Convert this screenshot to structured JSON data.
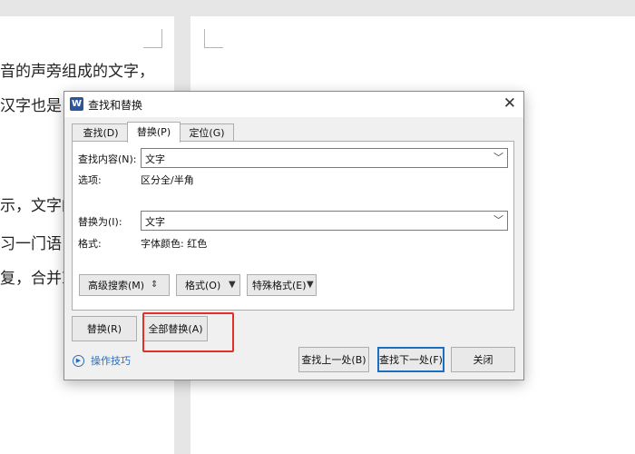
{
  "document": {
    "left_lines": [
      "音的声旁组成的文字，",
      "汉字也是",
      "",
      "示，文字的",
      "习一门语",
      "复，合并I"
    ]
  },
  "dialog": {
    "title": "查找和替换",
    "app_icon_letter": "W",
    "close_glyph": "✕",
    "tabs": [
      {
        "label": "查找(D)",
        "active": false
      },
      {
        "label": "替换(P)",
        "active": true
      },
      {
        "label": "定位(G)",
        "active": false
      }
    ],
    "find": {
      "label": "查找内容(N):",
      "value": "文字"
    },
    "options": {
      "label": "选项:",
      "value": "区分全/半角"
    },
    "replace": {
      "label": "替换为(I):",
      "value": "文字"
    },
    "format": {
      "label": "格式:",
      "value": "字体颜色: 红色"
    },
    "buttons": {
      "advanced_search": "高级搜索(M)",
      "format": "格式(O)",
      "special_format": "特殊格式(E)",
      "replace": "替换(R)",
      "replace_all": "全部替换(A)",
      "find_previous": "查找上一处(B)",
      "find_next": "查找下一处(F)",
      "close": "关闭"
    },
    "tips": "操作技巧"
  },
  "colors": {
    "highlight": "#e0302a",
    "link": "#2a6ebb",
    "accent": "#1d6fc4"
  }
}
